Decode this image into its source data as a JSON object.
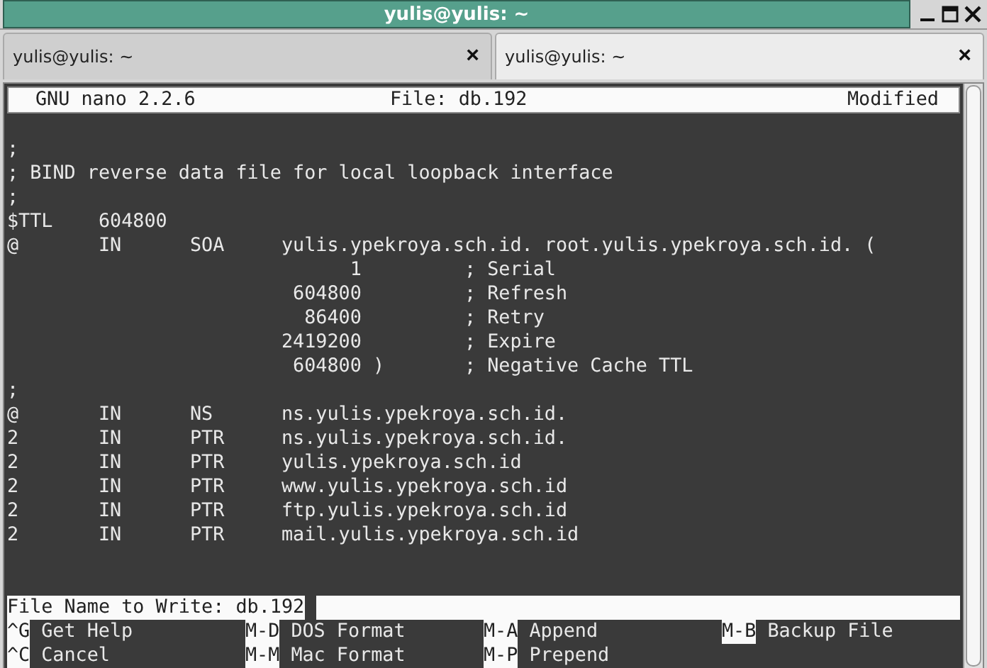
{
  "window": {
    "title": "yulis@yulis: ~"
  },
  "tabs": [
    {
      "label": "yulis@yulis: ~",
      "close": "×",
      "selected": false
    },
    {
      "label": "yulis@yulis: ~",
      "close": "×",
      "selected": true
    }
  ],
  "nano_header": {
    "version": "GNU nano 2.2.6",
    "file": "File: db.192",
    "status": "Modified"
  },
  "lines": [
    ";",
    "; BIND reverse data file for local loopback interface",
    ";",
    "$TTL    604800",
    "@       IN      SOA     yulis.ypekroya.sch.id. root.yulis.ypekroya.sch.id. (",
    "                              1         ; Serial",
    "                         604800         ; Refresh",
    "                          86400         ; Retry",
    "                        2419200         ; Expire",
    "                         604800 )       ; Negative Cache TTL",
    ";",
    "@       IN      NS      ns.yulis.ypekroya.sch.id.",
    "2       IN      PTR     ns.yulis.ypekroya.sch.id.",
    "2       IN      PTR     yulis.ypekroya.sch.id",
    "2       IN      PTR     www.yulis.ypekroya.sch.id",
    "2       IN      PTR     ftp.yulis.ypekroya.sch.id",
    "2       IN      PTR     mail.yulis.ypekroya.sch.id"
  ],
  "prompt": {
    "label": "File Name to Write:",
    "value": "db.192"
  },
  "shortcuts": [
    [
      {
        "key": "^G",
        "label": "Get Help"
      },
      {
        "key": "M-D",
        "label": "DOS Format"
      },
      {
        "key": "M-A",
        "label": "Append"
      },
      {
        "key": "M-B",
        "label": "Backup File"
      }
    ],
    [
      {
        "key": "^C",
        "label": "Cancel"
      },
      {
        "key": "M-M",
        "label": "Mac Format"
      },
      {
        "key": "M-P",
        "label": "Prepend"
      }
    ]
  ]
}
